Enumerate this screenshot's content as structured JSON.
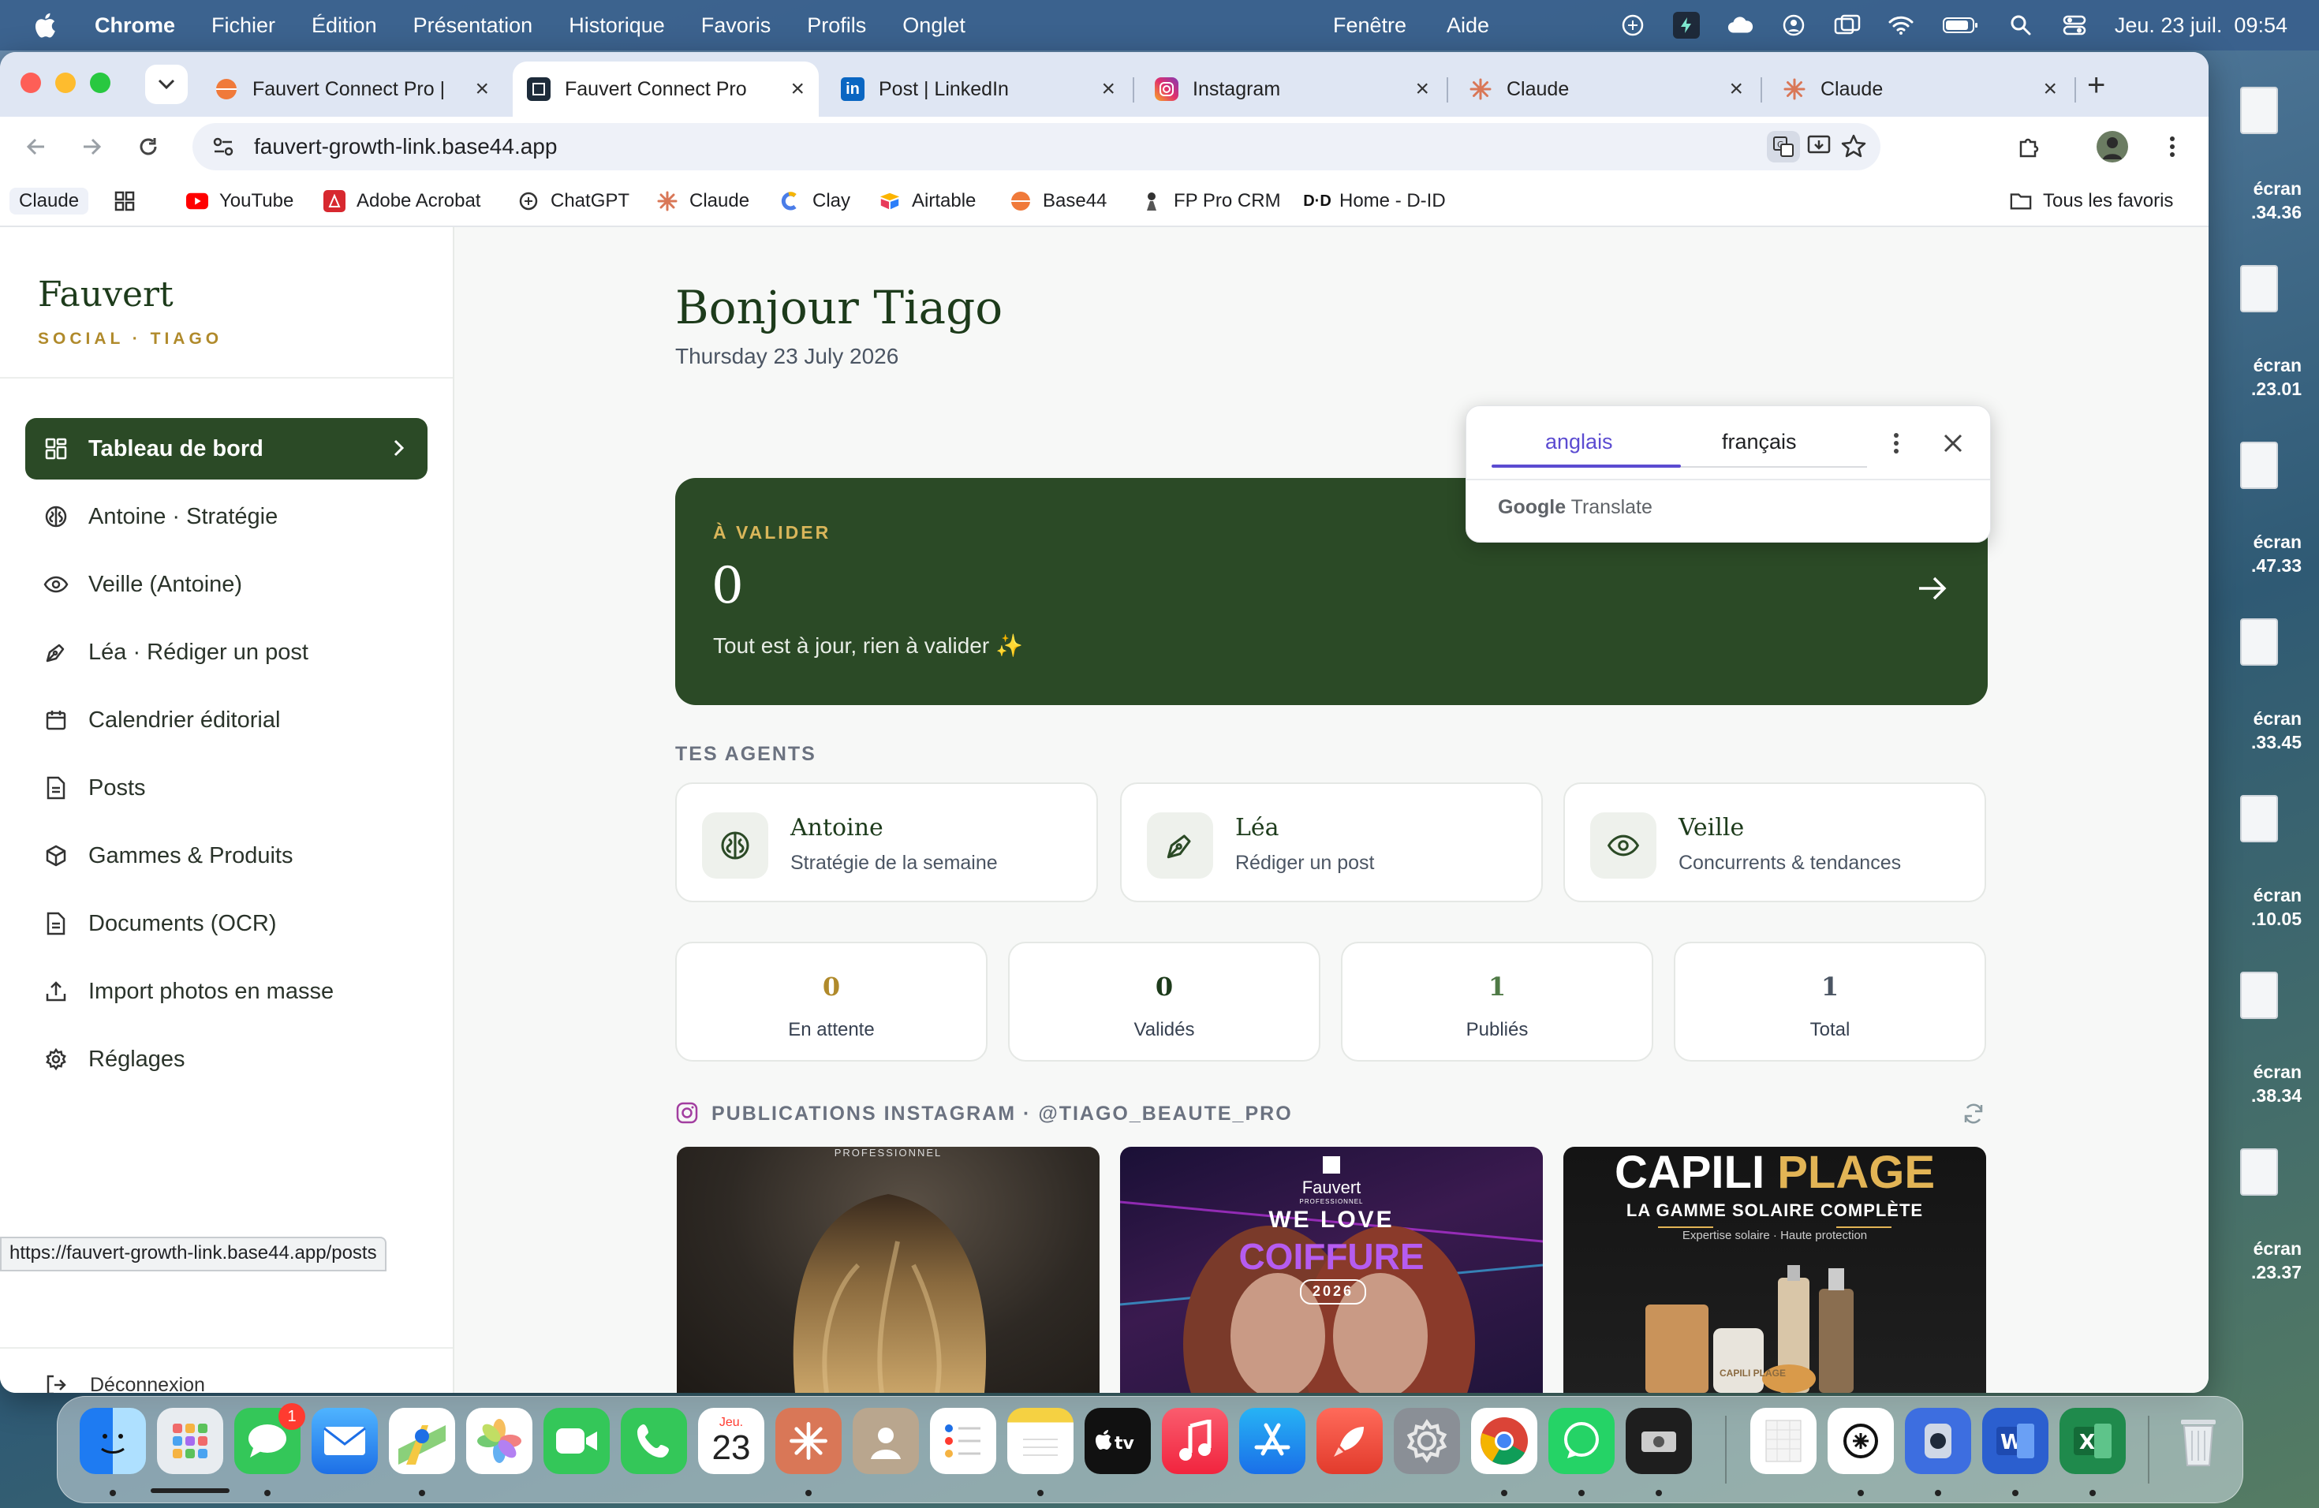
{
  "menubar": {
    "app_name": "Chrome",
    "items": [
      "Fichier",
      "Édition",
      "Présentation",
      "Historique",
      "Favoris",
      "Profils",
      "Onglet",
      "Fenêtre",
      "Aide"
    ],
    "clock": "Jeu. 23 juil.  09:54"
  },
  "desktop_files": [
    "écran\n.34.36",
    "écran\n.23.01",
    "écran\n.47.33",
    "écran\n.33.45",
    "écran\n.10.05",
    "écran\n.38.34",
    "écran\n.23.37"
  ],
  "browser": {
    "tabs": [
      {
        "label": "Fauvert Connect Pro | ",
        "active": false,
        "icon": "base44-icon"
      },
      {
        "label": "Fauvert Connect Pro",
        "active": true,
        "icon": "fauvert-icon"
      },
      {
        "label": "Post | LinkedIn",
        "active": false,
        "icon": "linkedin-icon"
      },
      {
        "label": "Instagram",
        "active": false,
        "icon": "instagram-icon"
      },
      {
        "label": "Claude",
        "active": false,
        "icon": "claude-icon"
      },
      {
        "label": "Claude",
        "active": false,
        "icon": "claude-icon"
      }
    ],
    "url": "fauvert-growth-link.base44.app",
    "bookmarks": [
      {
        "label": "Claude",
        "icon": "none"
      },
      {
        "label": "",
        "icon": "apps-grid-icon"
      },
      {
        "label": "YouTube",
        "icon": "youtube-icon"
      },
      {
        "label": "Adobe Acrobat",
        "icon": "acrobat-icon"
      },
      {
        "label": "ChatGPT",
        "icon": "chatgpt-icon"
      },
      {
        "label": "Claude",
        "icon": "claude-icon"
      },
      {
        "label": "Clay",
        "icon": "clay-icon"
      },
      {
        "label": "Airtable",
        "icon": "airtable-icon"
      },
      {
        "label": "Base44",
        "icon": "base44-icon"
      },
      {
        "label": "FP Pro CRM",
        "icon": "crm-icon"
      },
      {
        "label": "Home - D-ID",
        "icon": "did-icon"
      }
    ],
    "all_bookmarks": "Tous les favoris",
    "status_url": "https://fauvert-growth-link.base44.app/posts"
  },
  "translate_popup": {
    "lang_a": "anglais",
    "lang_b": "français",
    "google": "Google",
    "translate": "Translate"
  },
  "sidebar": {
    "brand": "Fauvert",
    "subtitle": "SOCIAL · TIAGO",
    "items": [
      {
        "label": "Tableau de bord",
        "icon": "dashboard-icon",
        "active": true
      },
      {
        "label": "Antoine · Stratégie",
        "icon": "brain-icon",
        "active": false
      },
      {
        "label": "Veille (Antoine)",
        "icon": "eye-icon",
        "active": false
      },
      {
        "label": "Léa · Rédiger un post",
        "icon": "pen-icon",
        "active": false
      },
      {
        "label": "Calendrier éditorial",
        "icon": "calendar-icon",
        "active": false
      },
      {
        "label": "Posts",
        "icon": "document-icon",
        "active": false
      },
      {
        "label": "Gammes & Produits",
        "icon": "box-icon",
        "active": false
      },
      {
        "label": "Documents (OCR)",
        "icon": "document-icon",
        "active": false
      },
      {
        "label": "Import photos en masse",
        "icon": "upload-icon",
        "active": false
      },
      {
        "label": "Réglages",
        "icon": "gear-icon",
        "active": false
      }
    ],
    "logout": "Déconnexion"
  },
  "main": {
    "greeting": "Bonjour Tiago",
    "date": "Thursday 23 July 2026",
    "validate": {
      "label": "À VALIDER",
      "count": "0",
      "message": "Tout est à jour, rien à valider ✨"
    },
    "agents_title": "TES AGENTS",
    "agents": [
      {
        "name": "Antoine",
        "desc": "Stratégie de la semaine",
        "icon": "brain-icon"
      },
      {
        "name": "Léa",
        "desc": "Rédiger un post",
        "icon": "pen-icon"
      },
      {
        "name": "Veille",
        "desc": "Concurrents & tendances",
        "icon": "eye-icon"
      }
    ],
    "stats": [
      {
        "value": "0",
        "label": "En attente",
        "color": "#b08a2b"
      },
      {
        "value": "0",
        "label": "Validés",
        "color": "#1d3b1b"
      },
      {
        "value": "1",
        "label": "Publiés",
        "color": "#4f7a46"
      },
      {
        "value": "1",
        "label": "Total",
        "color": "#4b5563"
      }
    ],
    "instagram_title": "PUBLICATIONS INSTAGRAM · @TIAGO_BEAUTE_PRO",
    "posts": [
      {
        "kind": "hair-photo",
        "top_text": "PROFESSIONNEL"
      },
      {
        "kind": "we-love-coiffure",
        "brand": "Fauvert",
        "brand_sub": "PROFESSIONNEL",
        "line1": "WE LOVE",
        "line2": "COIFFURE",
        "year": "2026"
      },
      {
        "kind": "capili-plage",
        "title_a": "CAPILI",
        "title_b": "PLAGE",
        "subtitle": "LA GAMME SOLAIRE COMPLÈTE",
        "tagline": "Expertise solaire · Haute protection",
        "product_text": "CAPILI PLAGE"
      }
    ]
  },
  "dock": {
    "messages_badge": "1",
    "calendar_month": "Jeu.",
    "calendar_day": "23"
  },
  "colors": {
    "brand_green": "#2b4a26",
    "gold": "#b08a2b",
    "translate_accent": "#5b4bd1"
  }
}
